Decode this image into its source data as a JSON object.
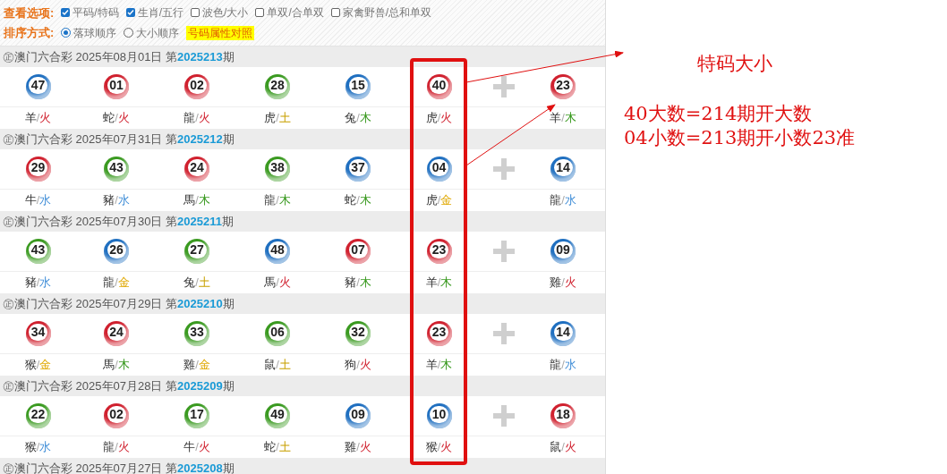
{
  "view_options": {
    "label": "查看选项:",
    "items": [
      {
        "label": "平码/特码",
        "checked": true
      },
      {
        "label": "生肖/五行",
        "checked": true
      },
      {
        "label": "波色/大小",
        "checked": false
      },
      {
        "label": "单双/合单双",
        "checked": false
      },
      {
        "label": "家禽野兽/总和单双",
        "checked": false
      }
    ]
  },
  "sort_options": {
    "label": "排序方式:",
    "items": [
      {
        "label": "落球顺序",
        "selected": true
      },
      {
        "label": "大小顺序",
        "selected": false
      }
    ],
    "button": "号码属性对照"
  },
  "draws": [
    {
      "header": "㊣澳门六合彩 2025年08月01日 第**2025213**期",
      "balls": [
        {
          "number": "47",
          "color": "#1f6fc0",
          "zodiac": "羊",
          "separator": "/",
          "element": "火",
          "kind": "fire"
        },
        {
          "number": "01",
          "color": "#d0202e",
          "zodiac": "蛇",
          "separator": "/",
          "element": "火",
          "kind": "fire"
        },
        {
          "number": "02",
          "color": "#d0202e",
          "zodiac": "龍",
          "separator": "/",
          "element": "火",
          "kind": "fire"
        },
        {
          "number": "28",
          "color": "#3a9a20",
          "zodiac": "虎",
          "separator": "/",
          "element": "土",
          "kind": "earth"
        },
        {
          "number": "15",
          "color": "#1f6fc0",
          "zodiac": "兔",
          "separator": "/",
          "element": "木",
          "kind": "wood"
        },
        {
          "number": "40",
          "color": "#d0202e",
          "zodiac": "虎",
          "separator": "/",
          "element": "火",
          "kind": "fire"
        },
        {
          "number": "23",
          "color": "#d0202e",
          "zodiac": "羊",
          "separator": "/",
          "element": "木",
          "kind": "wood"
        }
      ]
    },
    {
      "header": "㊣澳门六合彩 2025年07月31日 第**2025212**期",
      "balls": [
        {
          "number": "29",
          "color": "#d0202e",
          "zodiac": "牛",
          "separator": "/",
          "element": "水",
          "kind": "water"
        },
        {
          "number": "43",
          "color": "#3a9a20",
          "zodiac": "豬",
          "separator": "/",
          "element": "水",
          "kind": "water"
        },
        {
          "number": "24",
          "color": "#d0202e",
          "zodiac": "馬",
          "separator": "/",
          "element": "木",
          "kind": "wood"
        },
        {
          "number": "38",
          "color": "#3a9a20",
          "zodiac": "龍",
          "separator": "/",
          "element": "木",
          "kind": "wood"
        },
        {
          "number": "37",
          "color": "#1f6fc0",
          "zodiac": "蛇",
          "separator": "/",
          "element": "木",
          "kind": "wood"
        },
        {
          "number": "04",
          "color": "#1f6fc0",
          "zodiac": "虎",
          "separator": "/",
          "element": "金",
          "kind": "metal"
        },
        {
          "number": "14",
          "color": "#1f6fc0",
          "zodiac": "龍",
          "separator": "/",
          "element": "水",
          "kind": "water"
        }
      ]
    },
    {
      "header": "㊣澳门六合彩 2025年07月30日 第**2025211**期",
      "balls": [
        {
          "number": "43",
          "color": "#3a9a20",
          "zodiac": "豬",
          "separator": "/",
          "element": "水",
          "kind": "water"
        },
        {
          "number": "26",
          "color": "#1f6fc0",
          "zodiac": "龍",
          "separator": "/",
          "element": "金",
          "kind": "metal"
        },
        {
          "number": "27",
          "color": "#3a9a20",
          "zodiac": "兔",
          "separator": "/",
          "element": "土",
          "kind": "earth"
        },
        {
          "number": "48",
          "color": "#1f6fc0",
          "zodiac": "馬",
          "separator": "/",
          "element": "火",
          "kind": "fire"
        },
        {
          "number": "07",
          "color": "#d0202e",
          "zodiac": "豬",
          "separator": "/",
          "element": "木",
          "kind": "wood"
        },
        {
          "number": "23",
          "color": "#d0202e",
          "zodiac": "羊",
          "separator": "/",
          "element": "木",
          "kind": "wood"
        },
        {
          "number": "09",
          "color": "#1f6fc0",
          "zodiac": "雞",
          "separator": "/",
          "element": "火",
          "kind": "fire"
        }
      ]
    },
    {
      "header": "㊣澳门六合彩 2025年07月29日 第**2025210**期",
      "balls": [
        {
          "number": "34",
          "color": "#d0202e",
          "zodiac": "猴",
          "separator": "/",
          "element": "金",
          "kind": "metal"
        },
        {
          "number": "24",
          "color": "#d0202e",
          "zodiac": "馬",
          "separator": "/",
          "element": "木",
          "kind": "wood"
        },
        {
          "number": "33",
          "color": "#3a9a20",
          "zodiac": "雞",
          "separator": "/",
          "element": "金",
          "kind": "metal"
        },
        {
          "number": "06",
          "color": "#3a9a20",
          "zodiac": "鼠",
          "separator": "/",
          "element": "土",
          "kind": "earth"
        },
        {
          "number": "32",
          "color": "#3a9a20",
          "zodiac": "狗",
          "separator": "/",
          "element": "火",
          "kind": "fire"
        },
        {
          "number": "23",
          "color": "#d0202e",
          "zodiac": "羊",
          "separator": "/",
          "element": "木",
          "kind": "wood"
        },
        {
          "number": "14",
          "color": "#1f6fc0",
          "zodiac": "龍",
          "separator": "/",
          "element": "水",
          "kind": "water"
        }
      ]
    },
    {
      "header": "㊣澳门六合彩 2025年07月28日 第**2025209**期",
      "balls": [
        {
          "number": "22",
          "color": "#3a9a20",
          "zodiac": "猴",
          "separator": "/",
          "element": "水",
          "kind": "water"
        },
        {
          "number": "02",
          "color": "#d0202e",
          "zodiac": "龍",
          "separator": "/",
          "element": "火",
          "kind": "fire"
        },
        {
          "number": "17",
          "color": "#3a9a20",
          "zodiac": "牛",
          "separator": "/",
          "element": "火",
          "kind": "fire"
        },
        {
          "number": "49",
          "color": "#3a9a20",
          "zodiac": "蛇",
          "separator": "/",
          "element": "土",
          "kind": "earth"
        },
        {
          "number": "09",
          "color": "#1f6fc0",
          "zodiac": "雞",
          "separator": "/",
          "element": "火",
          "kind": "fire"
        },
        {
          "number": "10",
          "color": "#1f6fc0",
          "zodiac": "猴",
          "separator": "/",
          "element": "火",
          "kind": "fire"
        },
        {
          "number": "18",
          "color": "#d0202e",
          "zodiac": "鼠",
          "separator": "/",
          "element": "火",
          "kind": "fire"
        }
      ]
    },
    {
      "header": "㊣澳门六合彩 2025年07月27日 第**2025208**期"
    }
  ],
  "annotation": {
    "title": "特码大小",
    "lines": [
      "40大数=214期开大数",
      "04小数=213期开小数23准"
    ]
  }
}
